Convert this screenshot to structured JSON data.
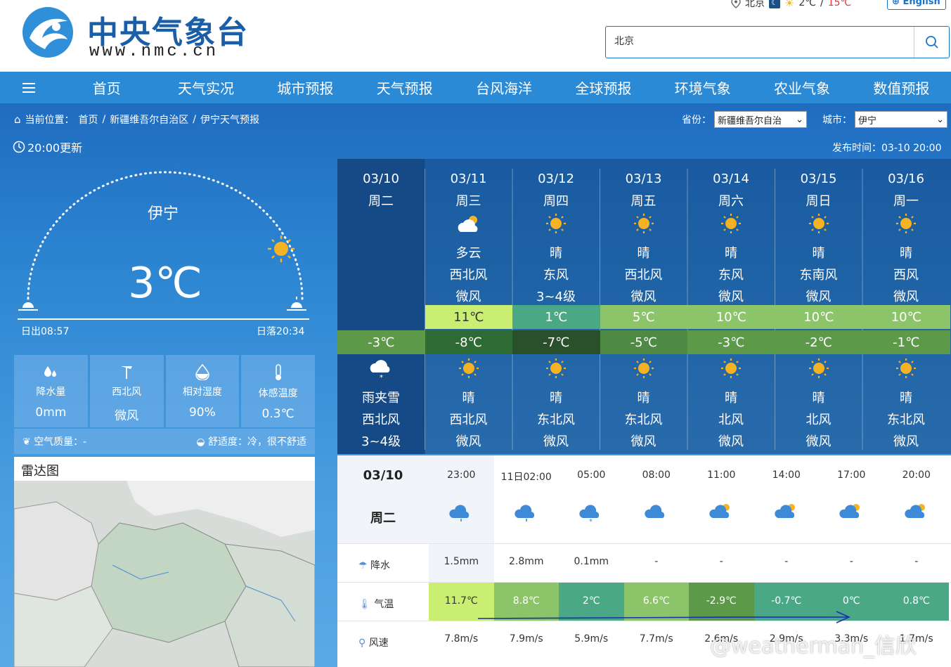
{
  "header": {
    "logo_title": "中央气象台",
    "logo_url": "www.nmc.cn",
    "location": "北京",
    "temp_low": "2℃",
    "temp_sep": "/",
    "temp_high": "15℃",
    "english_label": "English",
    "search_value": "北京"
  },
  "nav": {
    "items": [
      "首页",
      "天气实况",
      "城市预报",
      "天气预报",
      "台风海洋",
      "全球预报",
      "环境气象",
      "农业气象",
      "数值预报"
    ]
  },
  "breadcrumb": {
    "label": "当前位置：",
    "items": [
      "首页",
      "新疆维吾尔自治区",
      "伊宁天气预报"
    ],
    "sep": "/"
  },
  "selectors": {
    "province_label": "省份：",
    "province": "新疆维吾尔自治",
    "city_label": "城市：",
    "city": "伊宁"
  },
  "update": "20:00更新",
  "pubtime": "发布时间：03-10 20:00",
  "current": {
    "city": "伊宁",
    "temp": "3℃",
    "sunrise": "日出08:57",
    "sunset": "日落20:34"
  },
  "stats": [
    {
      "icon": "raindrop-icon",
      "label": "降水量",
      "value": "0mm"
    },
    {
      "icon": "wind-vane-icon",
      "label": "西北风",
      "value": "微风"
    },
    {
      "icon": "humidity-icon",
      "label": "相对湿度",
      "value": "90%"
    },
    {
      "icon": "thermometer-icon",
      "label": "体感温度",
      "value": "0.3℃"
    }
  ],
  "air": {
    "label": "空气质量：-",
    "comfort": "舒适度：冷，很不舒适"
  },
  "radar": {
    "title": "雷达图"
  },
  "days": [
    {
      "date": "03/10",
      "week": "周二",
      "day_weather": "",
      "day_wind_dir": "",
      "day_wind": "",
      "high": "",
      "low": "-3℃",
      "night_icon": "snow-cloud-icon",
      "night_weather": "雨夹雪",
      "night_wind_dir": "西北风",
      "night_wind": "3~4级"
    },
    {
      "date": "03/11",
      "week": "周三",
      "day_icon": "cloud-sun-icon",
      "day_weather": "多云",
      "day_wind_dir": "西北风",
      "day_wind": "微风",
      "high": "11℃",
      "low": "-8℃",
      "night_icon": "sun-icon",
      "night_weather": "晴",
      "night_wind_dir": "西北风",
      "night_wind": "微风"
    },
    {
      "date": "03/12",
      "week": "周四",
      "day_icon": "sun-icon",
      "day_weather": "晴",
      "day_wind_dir": "东风",
      "day_wind": "3~4级",
      "high": "1℃",
      "low": "-7℃",
      "night_icon": "sun-icon",
      "night_weather": "晴",
      "night_wind_dir": "东北风",
      "night_wind": "微风"
    },
    {
      "date": "03/13",
      "week": "周五",
      "day_icon": "sun-icon",
      "day_weather": "晴",
      "day_wind_dir": "西北风",
      "day_wind": "微风",
      "high": "5℃",
      "low": "-5℃",
      "night_icon": "sun-icon",
      "night_weather": "晴",
      "night_wind_dir": "东北风",
      "night_wind": "微风"
    },
    {
      "date": "03/14",
      "week": "周六",
      "day_icon": "sun-icon",
      "day_weather": "晴",
      "day_wind_dir": "东风",
      "day_wind": "微风",
      "high": "10℃",
      "low": "-3℃",
      "night_icon": "sun-icon",
      "night_weather": "晴",
      "night_wind_dir": "北风",
      "night_wind": "微风"
    },
    {
      "date": "03/15",
      "week": "周日",
      "day_icon": "sun-icon",
      "day_weather": "晴",
      "day_wind_dir": "东南风",
      "day_wind": "微风",
      "high": "10℃",
      "low": "-2℃",
      "night_icon": "sun-icon",
      "night_weather": "晴",
      "night_wind_dir": "北风",
      "night_wind": "微风"
    },
    {
      "date": "03/16",
      "week": "周一",
      "day_icon": "sun-icon",
      "day_weather": "晴",
      "day_wind_dir": "西风",
      "day_wind": "微风",
      "high": "10℃",
      "low": "-1℃",
      "night_icon": "sun-icon",
      "night_weather": "晴",
      "night_wind_dir": "东北风",
      "night_wind": "微风"
    }
  ],
  "colors": {
    "high": [
      "#c9ee72",
      "#4aa886",
      "#8cc46a",
      "#8cc46a",
      "#8cc46a",
      "#8cc46a"
    ],
    "low": [
      "#5c9a4a",
      "#2e6a34",
      "#294f2b",
      "#4f8a45",
      "#5c9a4a",
      "#5c9a4a",
      "#5c9a4a"
    ]
  },
  "hourly": {
    "date": "03/10",
    "week": "周二",
    "precip_label": "降水",
    "temp_label": "气温",
    "wind_label": "风速",
    "times": [
      "23:00",
      "11日02:00",
      "05:00",
      "08:00",
      "11:00",
      "14:00",
      "17:00",
      "20:00"
    ],
    "icons": [
      "rain-cloud-icon",
      "rain-cloud-icon",
      "snow-cloud-icon",
      "cloud-icon",
      "cloud-sun-icon",
      "cloud-sun-icon",
      "cloud-sun-icon",
      "cloud-sun-icon"
    ],
    "precip": [
      "1.5mm",
      "2.8mm",
      "0.1mm",
      "-",
      "-",
      "-",
      "-",
      "-"
    ],
    "temps": [
      "11.7℃",
      "8.8℃",
      "2℃",
      "6.6℃",
      "-2.9℃",
      "-0.7℃",
      "0℃",
      "0.8℃"
    ],
    "temp_colors": [
      "#c9ee72",
      "#8cc46a",
      "#4aa886",
      "#8cc46a",
      "#5c9a4a",
      "#4aa886",
      "#4aa886",
      "#4aa886"
    ],
    "winds": [
      "7.8m/s",
      "7.9m/s",
      "5.9m/s",
      "7.7m/s",
      "2.6m/s",
      "2.9m/s",
      "3.3m/s",
      "1.7m/s"
    ]
  },
  "watermark": "@weatherman_信欣"
}
